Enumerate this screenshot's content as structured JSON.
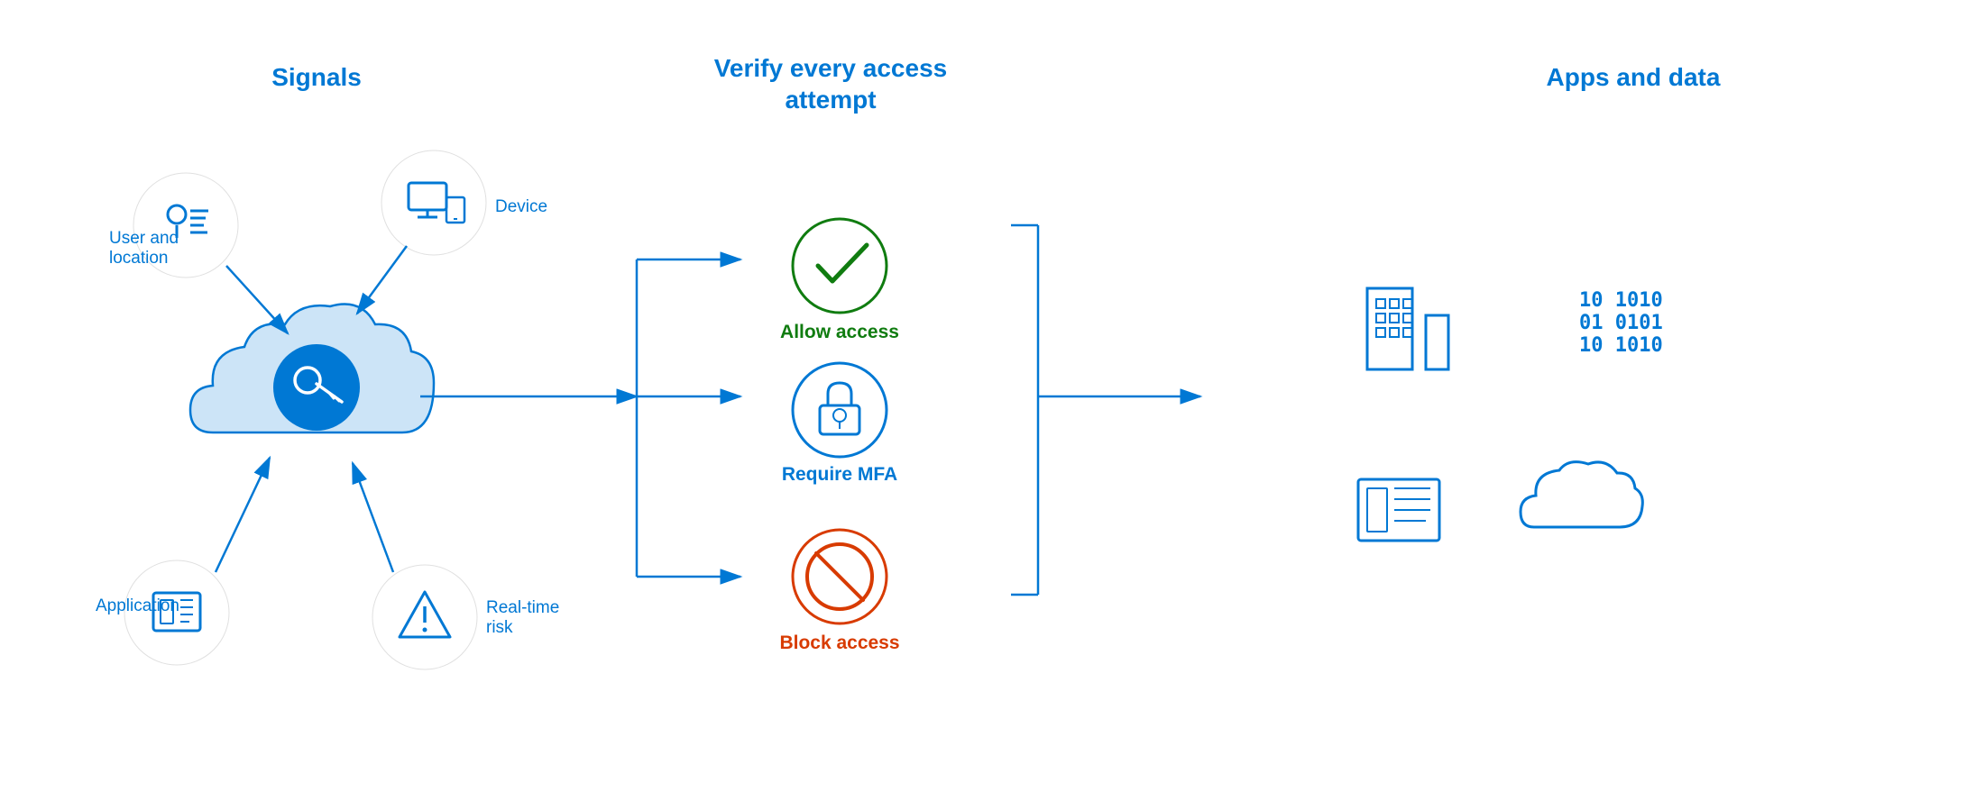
{
  "sections": {
    "signals": {
      "title": "Signals",
      "icons": [
        {
          "id": "user",
          "label": "User and\nlocation"
        },
        {
          "id": "device",
          "label": "Device"
        },
        {
          "id": "app",
          "label": "Application"
        },
        {
          "id": "risk",
          "label": "Real-time\nrisk"
        }
      ]
    },
    "verify": {
      "title": "Verify every access\nattempt",
      "outcomes": [
        {
          "id": "allow",
          "label": "Allow access",
          "color": "green"
        },
        {
          "id": "mfa",
          "label": "Require MFA",
          "color": "blue"
        },
        {
          "id": "block",
          "label": "Block access",
          "color": "red"
        }
      ]
    },
    "apps": {
      "title": "Apps and data",
      "icons": [
        {
          "id": "building",
          "label": ""
        },
        {
          "id": "data",
          "label": ""
        },
        {
          "id": "dashboard",
          "label": ""
        },
        {
          "id": "cloud",
          "label": ""
        }
      ]
    }
  },
  "colors": {
    "blue": "#0078d4",
    "green": "#107c10",
    "red": "#d83b01",
    "white": "#ffffff"
  }
}
